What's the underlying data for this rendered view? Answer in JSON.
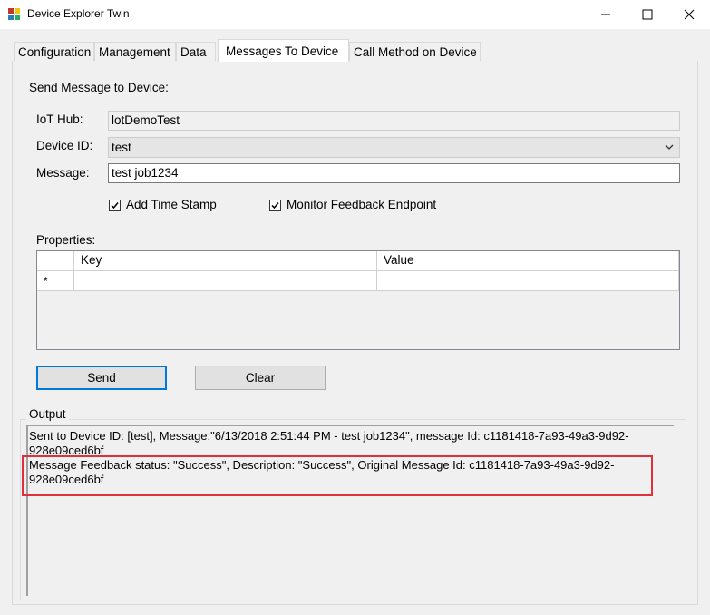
{
  "window": {
    "title": "Device Explorer Twin"
  },
  "tabs": [
    {
      "label": "Configuration"
    },
    {
      "label": "Management"
    },
    {
      "label": "Data"
    },
    {
      "label": "Messages To Device"
    },
    {
      "label": "Call Method on Device"
    }
  ],
  "active_tab": "Messages To Device",
  "form": {
    "section_label": "Send Message to Device:",
    "iot_hub_label": "IoT Hub:",
    "iot_hub_value": "lotDemoTest",
    "device_id_label": "Device ID:",
    "device_id_value": "test",
    "message_label": "Message:",
    "message_value": "test job1234",
    "add_timestamp_label": "Add Time Stamp",
    "add_timestamp_checked": true,
    "monitor_feedback_label": "Monitor Feedback Endpoint",
    "monitor_feedback_checked": true,
    "properties_label": "Properties:"
  },
  "properties_grid": {
    "columns": [
      "Key",
      "Value"
    ],
    "new_row_marker": "*"
  },
  "buttons": {
    "send": "Send",
    "clear": "Clear"
  },
  "output": {
    "group_label": "Output",
    "lines": [
      "Sent to Device ID: [test], Message:\"6/13/2018 2:51:44 PM - test job1234\", message Id: c1181418-7a93-49a3-9d92-928e09ced6bf",
      "Message Feedback status: \"Success\", Description: \"Success\", Original Message Id: c1181418-7a93-49a3-9d92-928e09ced6bf"
    ]
  },
  "colors": {
    "highlight_box": "#e0313a",
    "focus_border": "#0078d7"
  }
}
